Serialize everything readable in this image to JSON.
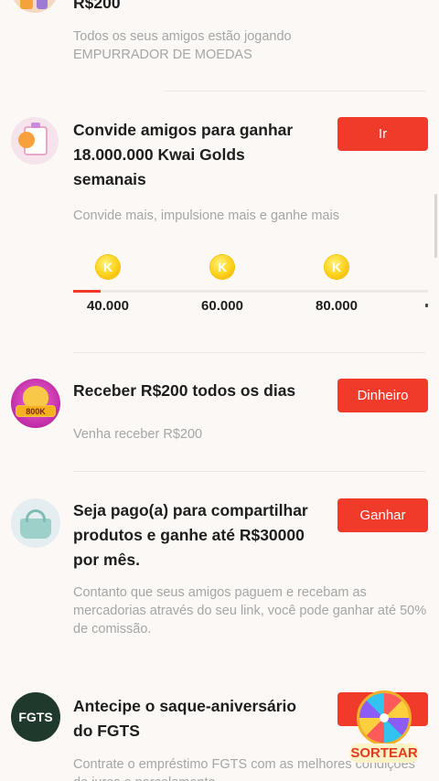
{
  "top_section": {
    "title_partial": "R$200",
    "desc": "Todos os seus amigos estão jogando EMPURRADOR DE MOEDAS"
  },
  "invite_task": {
    "title": "Convide amigos para ganhar 18.000.000 Kwai Golds semanais",
    "button": "Ir",
    "desc": "Convide mais, impulsione mais e ganhe mais",
    "milestones": [
      "40.000",
      "60.000",
      "80.000"
    ],
    "coin_letter": "K",
    "progress": 0
  },
  "daily_task": {
    "title": "Receber R$200 todos os dias",
    "button": "Dinheiro",
    "desc": "Venha receber R$200",
    "badge": "800K"
  },
  "share_task": {
    "title": "Seja pago(a) para compartilhar produtos e ganhe até R$30000 por mês.",
    "button": "Ganhar",
    "desc": "Contanto que seus amigos paguem e recebam as mercadorias através do seu link, você pode ganhar até 50% de comissão."
  },
  "fgts_task": {
    "icon_text": "FGTS",
    "title": "Antecipe o saque-aniversário do FGTS",
    "desc": "Contrate o empréstimo FGTS com as melhores condições de juros e parcelamento"
  },
  "floating_widget": {
    "label": "SORTEAR"
  },
  "colors": {
    "accent": "#f03a2a",
    "text": "#1e1e1e",
    "muted": "#a6a6a6",
    "background": "#fbf8f6"
  }
}
